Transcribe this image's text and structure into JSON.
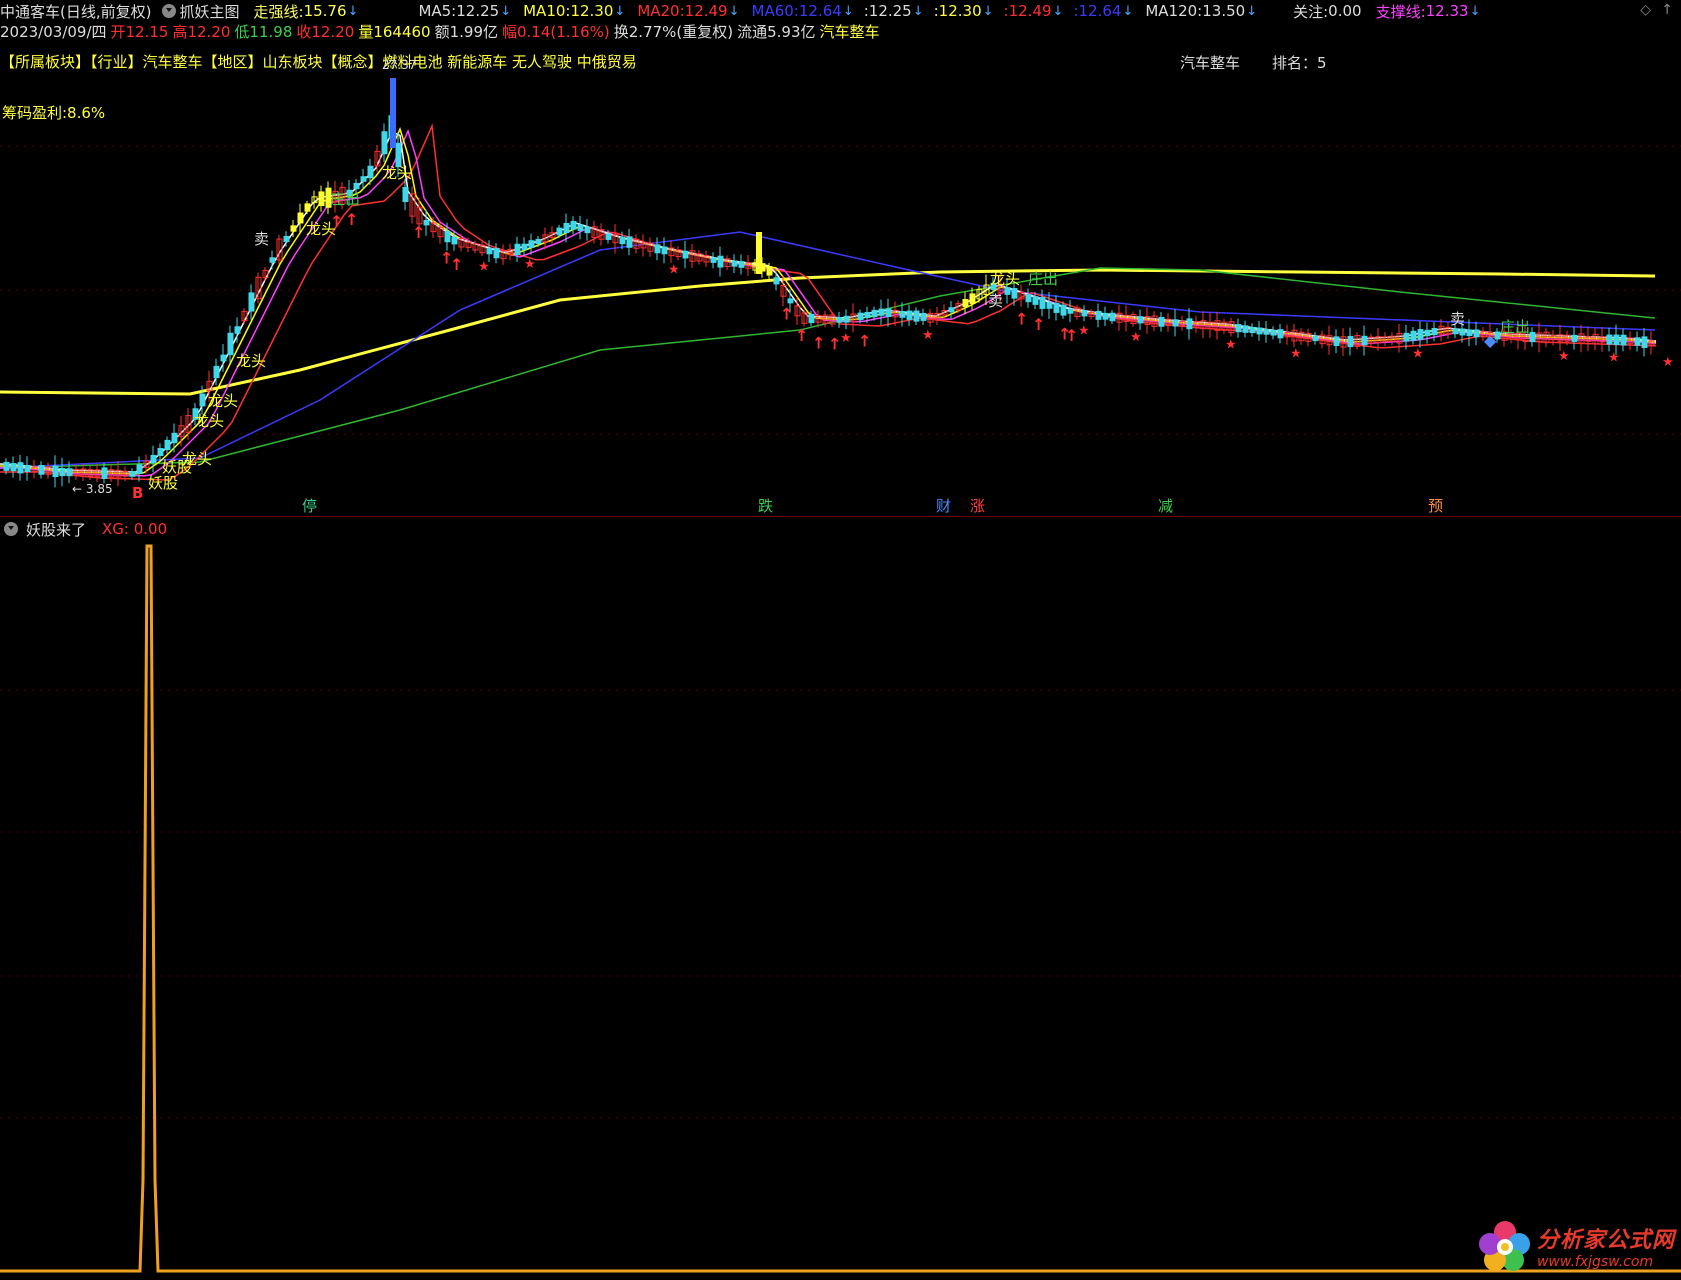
{
  "header": {
    "stock_name": "中通客车",
    "period": "(日线,前复权)",
    "indicator_main": "抓妖主图",
    "strong_label": "走强线:",
    "strong_value": "15.76",
    "ma5_label": "MA5:",
    "ma5_value": "12.25",
    "ma10_label": "MA10:",
    "ma10_value": "12.30",
    "ma20_label": "MA20:",
    "ma20_value": "12.49",
    "ma60_label": "MA60:",
    "ma60_value": "12.64",
    "extra1": ":12.25",
    "extra2": ":12.30",
    "extra3": ":12.49",
    "extra4": ":12.64",
    "ma120_label": "MA120:",
    "ma120_value": "13.50",
    "attention_label": "关注:",
    "attention_value": "0.00",
    "support_label": "支撑线:",
    "support_value": "12.33"
  },
  "quote": {
    "date": "2023/03/09/四",
    "open": "开12.15",
    "high": "高12.20",
    "low": "低11.98",
    "close": "收12.20",
    "volume": "量164460",
    "amount": "额1.99亿",
    "change": "幅0.14(1.16%)",
    "turnover": "换2.77%(重复权)",
    "float": "流通5.93亿",
    "sector": "汽车整车"
  },
  "tags": {
    "text_a": "【所属板块】【行业】汽车整车【地区】山东板块【概念】燃料电池 新能源车 无人驾驶 中俄贸易",
    "right_sector": "汽车整车",
    "rank": "排名：5"
  },
  "chips_profit": "筹码盈利:8.6%",
  "chart_labels": {
    "peak_value": "27.37",
    "low_value": "3.85",
    "sell": "卖",
    "dragon": "龙头",
    "demon": "妖股",
    "buy_b": "B",
    "zhuangchu": "庄出"
  },
  "bottom_markers": [
    {
      "text": "停",
      "color": "#3ecf8e"
    },
    {
      "text": "跌",
      "color": "#3ecf4e"
    },
    {
      "text": "财",
      "color": "#4a8cff"
    },
    {
      "text": "涨",
      "color": "#ff4040"
    },
    {
      "text": "减",
      "color": "#3ecf4e"
    },
    {
      "text": "预",
      "color": "#ff8c40"
    }
  ],
  "lower_panel": {
    "title": "妖股来了",
    "xg_label": "XG: 0.00"
  },
  "watermark": {
    "title": "分析家公式网",
    "url": "www.fxjgsw.com"
  },
  "colors": {
    "ma5": "#ffffff",
    "ma10": "#ffff00",
    "ma20": "#ff3030",
    "ma60": "#3b3bff",
    "ma120": "#ffffff",
    "support": "#ff40ff",
    "strong": "#ffff40",
    "green_line": "#2fb52f",
    "xg_line": "#f0a020"
  }
}
